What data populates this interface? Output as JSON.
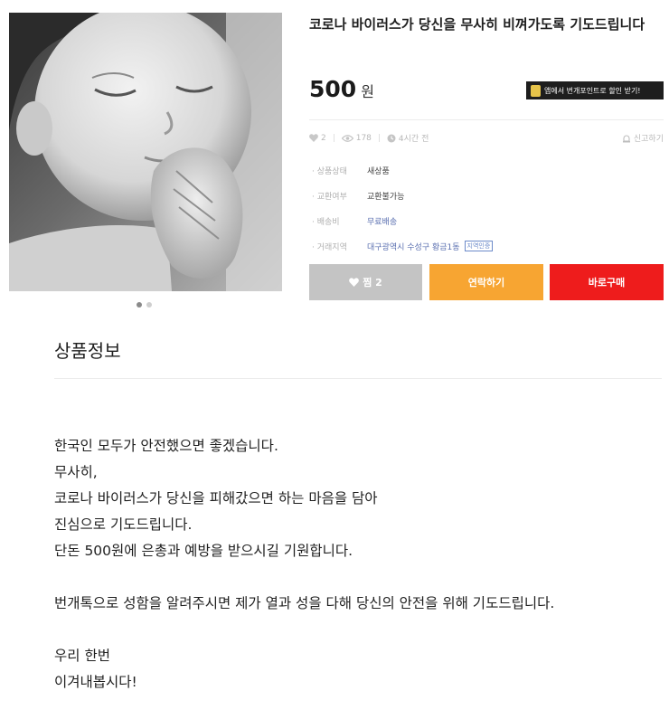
{
  "product": {
    "title": "코로나 바이러스가 당신을 무사히 비껴가도록 기도드립니다",
    "price": "500",
    "price_unit": "원",
    "promo_text": "앱에서 번개포인트로 할인 받기!",
    "image_icon": "child-praying-photo"
  },
  "stats": {
    "likes": "2",
    "views": "178",
    "time": "4시간 전",
    "report_label": "신고하기"
  },
  "info_rows": [
    {
      "label": "상품상태",
      "value": "새상품"
    },
    {
      "label": "교환여부",
      "value": "교환불가능"
    },
    {
      "label": "배송비",
      "value": "무료배송"
    },
    {
      "label": "거래지역",
      "value": "대구광역시 수성구 황금1동",
      "tag": "지역인증"
    }
  ],
  "buttons": {
    "like_label": "찜 2",
    "contact_label": "연락하기",
    "buy_label": "바로구매"
  },
  "description": {
    "heading": "상품정보",
    "paragraph1": [
      "한국인 모두가 안전했으면 좋겠습니다.",
      "무사히,",
      "코로나 바이러스가 당신을 피해갔으면 하는 마음을 담아",
      "진심으로 기도드립니다.",
      "단돈 500원에 은총과 예방을 받으시길 기원합니다."
    ],
    "paragraph2": "번개톡으로 성함을 알려주시면 제가 열과 성을 다해 당신의 안전을 위해 기도드립니다.",
    "paragraph3": [
      "우리 한번",
      "이겨내봅시다!"
    ]
  },
  "colors": {
    "like_button": "#c4c4c4",
    "contact_button": "#f7a532",
    "buy_button": "#ee1c1c"
  }
}
